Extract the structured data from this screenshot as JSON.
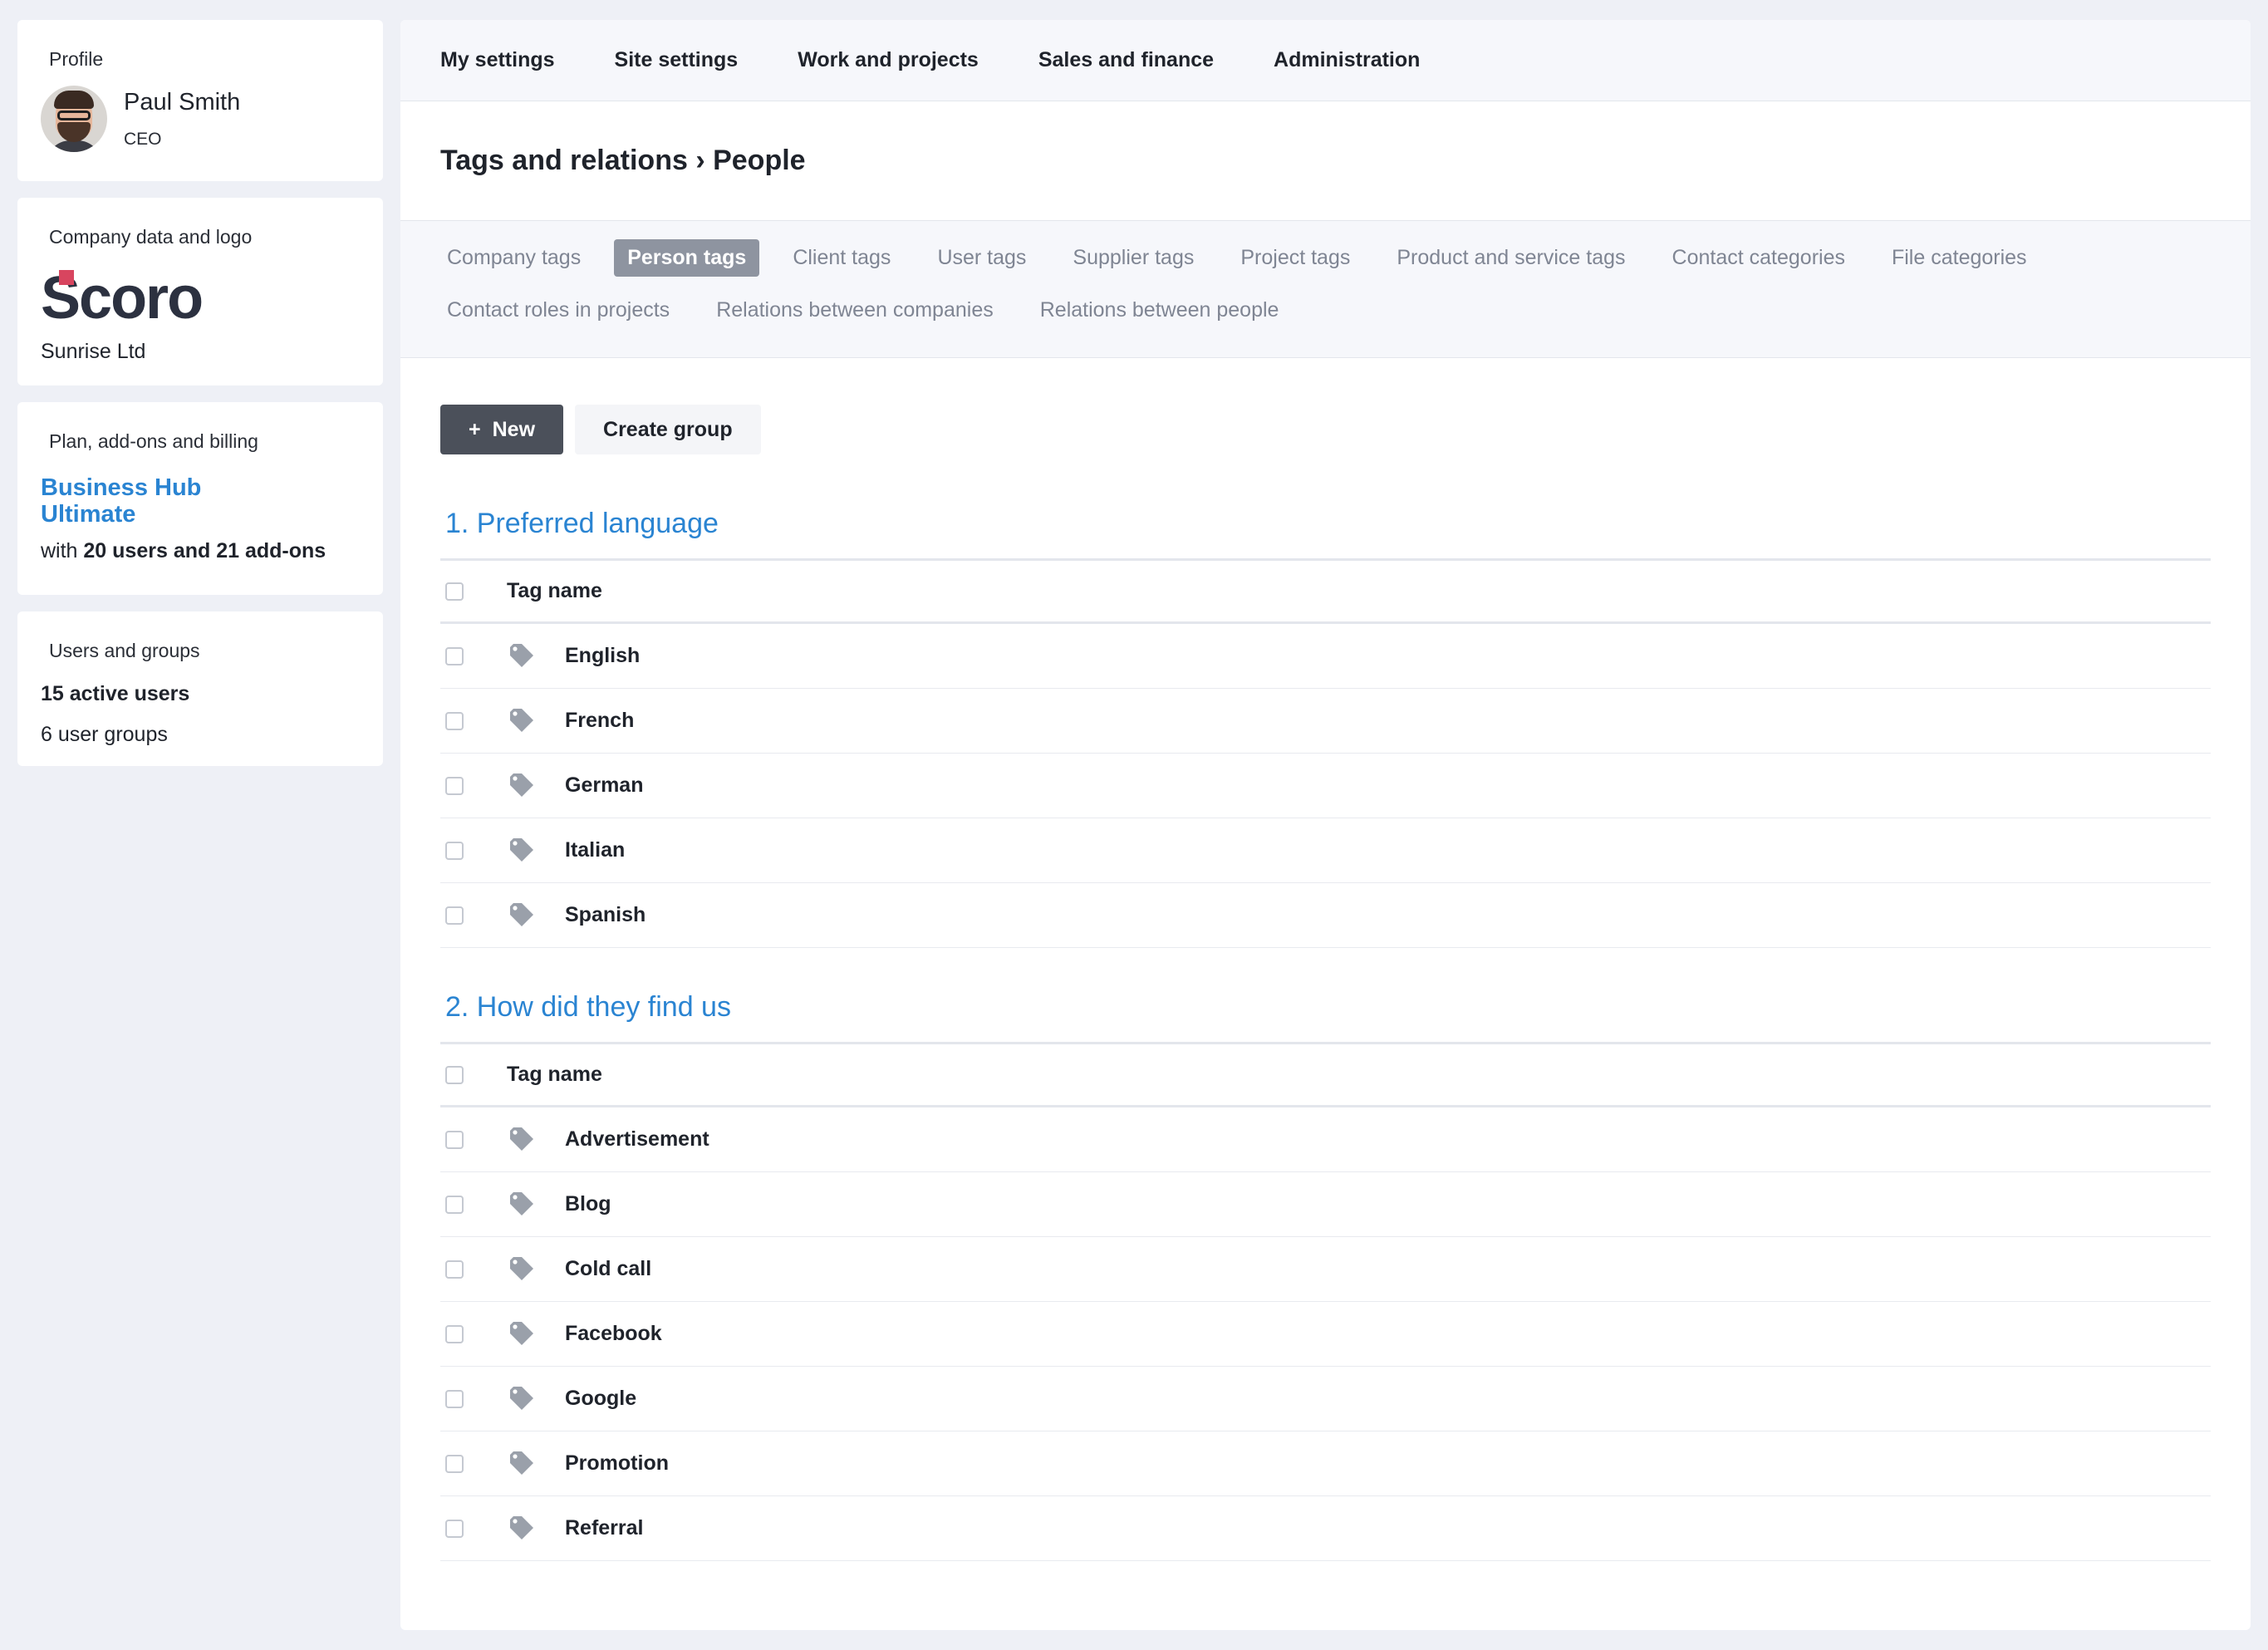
{
  "sidebar": {
    "profile": {
      "label": "Profile",
      "name": "Paul Smith",
      "role": "CEO"
    },
    "company": {
      "label": "Company data and logo",
      "logo_text": "Scoro",
      "name": "Sunrise Ltd"
    },
    "plan": {
      "label": "Plan, add-ons and billing",
      "name": "Business Hub Ultimate",
      "detail_prefix": "with ",
      "detail_bold": "20 users and 21 add-ons"
    },
    "users": {
      "label": "Users and groups",
      "active": "15 active users",
      "groups": "6 user groups"
    }
  },
  "topnav": [
    "My settings",
    "Site settings",
    "Work and projects",
    "Sales and finance",
    "Administration"
  ],
  "page_title": "Tags and relations › People",
  "subtabs": [
    "Company tags",
    "Person tags",
    "Client tags",
    "User tags",
    "Supplier tags",
    "Project tags",
    "Product and service tags",
    "Contact categories",
    "File categories",
    "Contact roles in projects",
    "Relations between companies",
    "Relations between people"
  ],
  "active_subtab": "Person tags",
  "actions": {
    "new_label": "New",
    "new_icon": "plus-icon",
    "create_group_label": "Create group"
  },
  "table_header": "Tag name",
  "groups": [
    {
      "title": "1. Preferred language",
      "tags": [
        "English",
        "French",
        "German",
        "Italian",
        "Spanish"
      ]
    },
    {
      "title": "2. How did they find us",
      "tags": [
        "Advertisement",
        "Blog",
        "Cold call",
        "Facebook",
        "Google",
        "Promotion",
        "Referral"
      ]
    }
  ],
  "colors": {
    "accent": "#2a84d2",
    "active_tab": "#8e94a0",
    "primary_button": "#4b505a",
    "logo_mark": "#d8455f",
    "tag_icon": "#9aa0aa"
  }
}
